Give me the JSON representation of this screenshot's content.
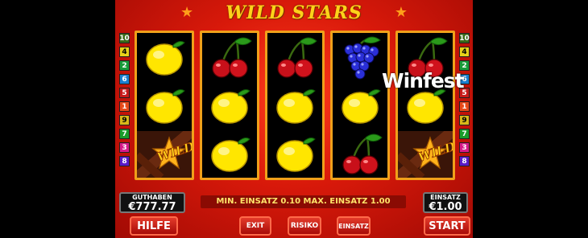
{
  "game": {
    "title": "WILD STARS",
    "watermark": "Winfest"
  },
  "paylines_left": [
    "10",
    "4",
    "2",
    "6",
    "5",
    "1",
    "9",
    "7",
    "3",
    "8"
  ],
  "paylines_right": [
    "10",
    "4",
    "2",
    "6",
    "5",
    "1",
    "9",
    "7",
    "3",
    "8"
  ],
  "payline_colors": [
    "#3a6b1a",
    "#e8d21a",
    "#1a9c3a",
    "#1a7fd0",
    "#c81a1a",
    "#e84a1a",
    "#d8b81a",
    "#1a9c2a",
    "#d81a8a",
    "#5a1ac8"
  ],
  "reels": [
    [
      "lemon",
      "lemon",
      "wild"
    ],
    [
      "cherry",
      "lemon",
      "lemon"
    ],
    [
      "cherry",
      "lemon",
      "lemon"
    ],
    [
      "grapes",
      "lemon",
      "cherry"
    ],
    [
      "cherry",
      "lemon",
      "wild"
    ]
  ],
  "wild_label": "WILD",
  "balance": {
    "label": "GUTHABEN",
    "value": "€777.77"
  },
  "bet": {
    "label": "EINSATZ",
    "value": "€1.00"
  },
  "message": "MIN. EINSATZ 0.10 MAX. EINSATZ 1.00",
  "buttons": {
    "help": "HILFE",
    "exit": "EXIT",
    "risk": "RISIKO",
    "bet": "EINSATZ",
    "start": "START"
  }
}
